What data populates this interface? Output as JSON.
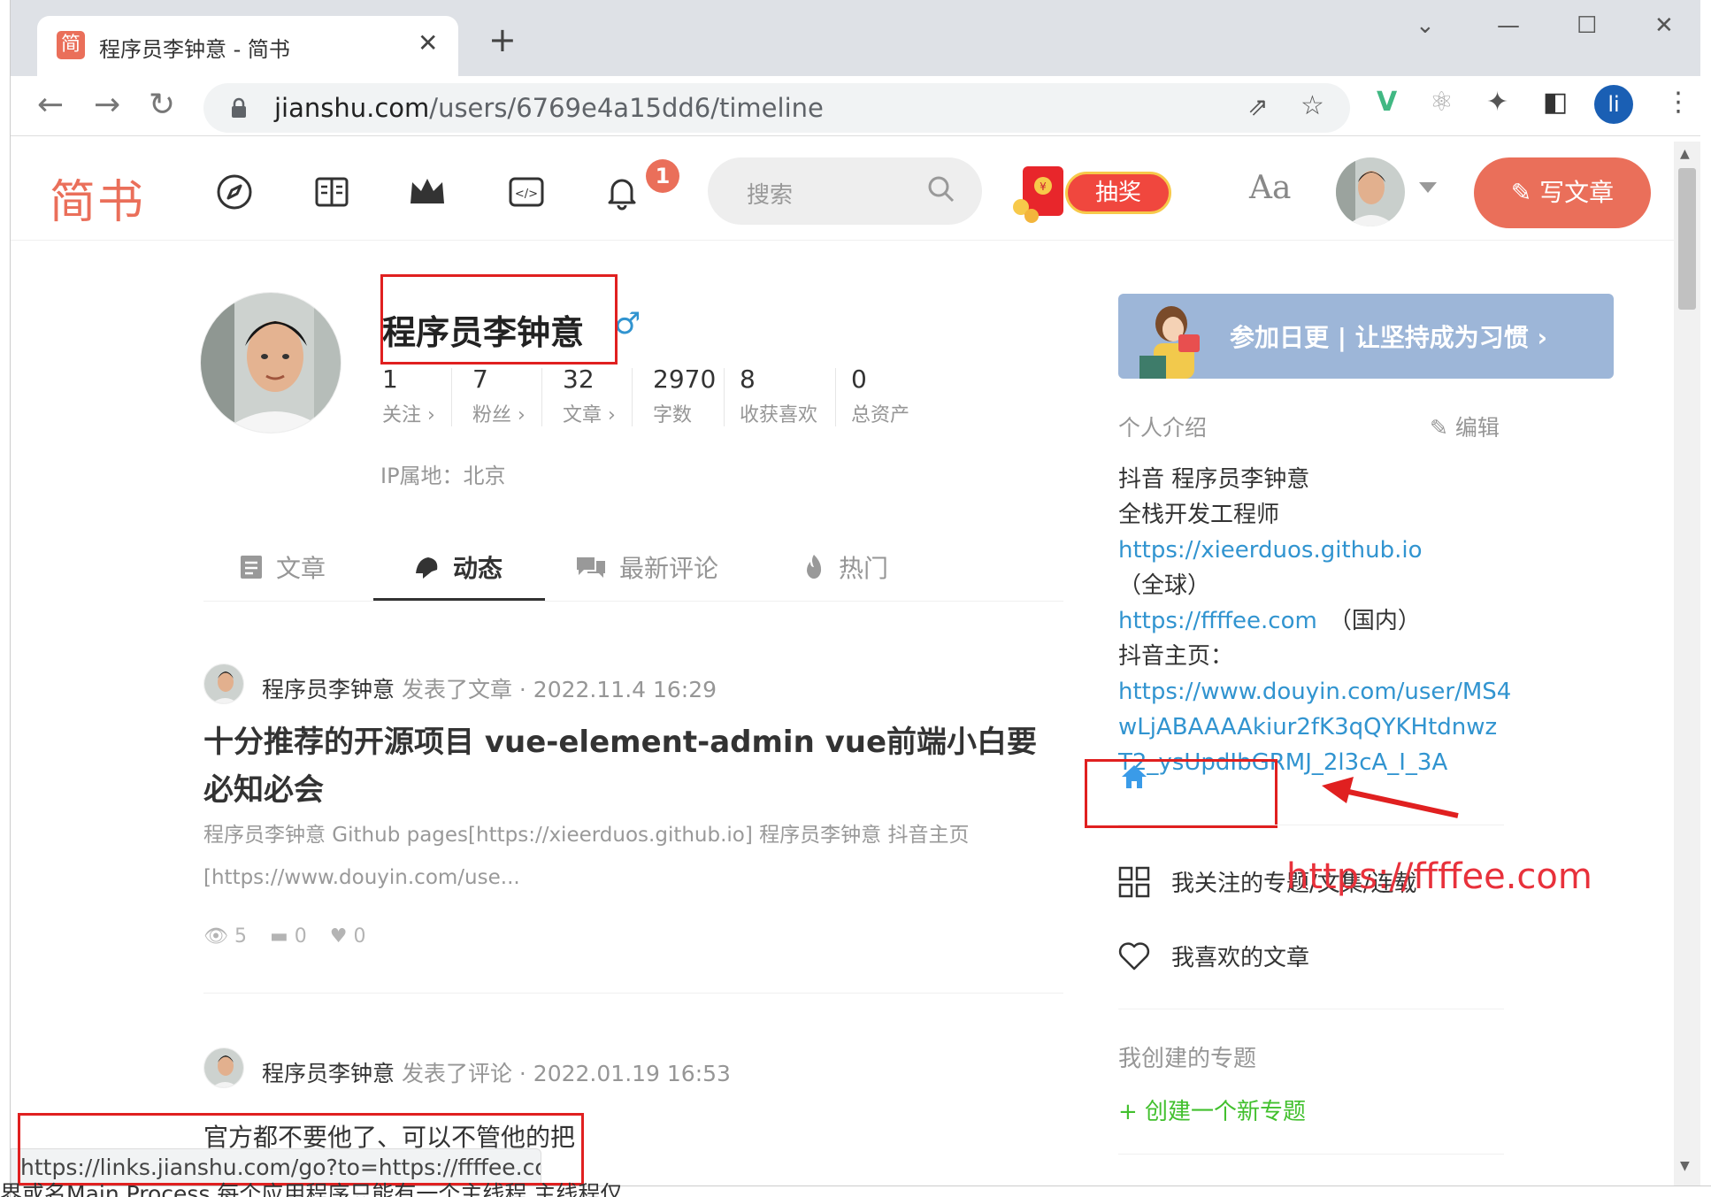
{
  "browser": {
    "tab_title": "程序员李钟意 - 简书",
    "tab_favicon": "简",
    "url_host": "jianshu.com",
    "url_path": "/users/6769e4a15dd6/timeline"
  },
  "header": {
    "logo": "简书",
    "notification_count": "1",
    "search_placeholder": "搜索",
    "lottery_label": "抽奖",
    "font_toggle": "Aa",
    "write_label": "写文章"
  },
  "profile": {
    "name": "程序员李钟意",
    "gender_symbol": "♂",
    "ip": "IP属地：北京",
    "stats": [
      {
        "num": "1",
        "label": "关注 ›"
      },
      {
        "num": "7",
        "label": "粉丝 ›"
      },
      {
        "num": "32",
        "label": "文章 ›"
      },
      {
        "num": "2970",
        "label": "字数"
      },
      {
        "num": "8",
        "label": "收获喜欢"
      },
      {
        "num": "0",
        "label": "总资产"
      }
    ]
  },
  "tabs": [
    {
      "label": "文章",
      "icon": "document-icon"
    },
    {
      "label": "动态",
      "icon": "bell-shape-icon"
    },
    {
      "label": "最新评论",
      "icon": "comments-icon"
    },
    {
      "label": "热门",
      "icon": "fire-icon"
    }
  ],
  "feed": [
    {
      "author": "程序员李钟意",
      "action": "发表了文章 · 2022.11.4 16:29",
      "title": "十分推荐的开源项目 vue-element-admin vue前端小白要必知必会",
      "abstract": "程序员李钟意 Github pages[https://xieerduos.github.io] 程序员李钟意 抖音主页[https://www.douyin.com/use...",
      "views": "5",
      "comments": "0",
      "likes": "0"
    },
    {
      "author": "程序员李钟意",
      "action": "发表了评论 · 2022.01.19 16:53",
      "title": "官方都不要他了、可以不管他的把"
    }
  ],
  "sidebar": {
    "banner": "参加日更 | 让坚持成为习惯  ›",
    "intro_heading": "个人介绍",
    "edit_label": "编辑",
    "bio_line1": "抖音 程序员李钟意",
    "bio_line2": "全栈开发工程师",
    "link1": "https://xieerduos.github.io",
    "link1_suffix": "（全球）",
    "link2": "https://ffffee.com",
    "link2_suffix": "　（国内）",
    "bio_line5": "抖音主页：",
    "link3_a": "https://www.douyin.com/user/MS4",
    "link3_b": "wLjABAAAAkiur2fK3qQYKHtdnwz",
    "link3_c": "T2_ysUpdIbGRMJ_2l3cA_I_3A",
    "followed_collections": "我关注的专题/文集/连载",
    "liked_articles": "我喜欢的文章",
    "created_topics": "我创建的专题",
    "create_topic": "+ 创建一个新专题"
  },
  "annotation": {
    "watermark": "https://ffffee.com"
  },
  "statusbar": {
    "url": "https://links.jianshu.com/go?to=https://ffffee.com"
  },
  "background_text": "界或名Main Process,每个应用程序只能有一个主线程,主线程仅"
}
